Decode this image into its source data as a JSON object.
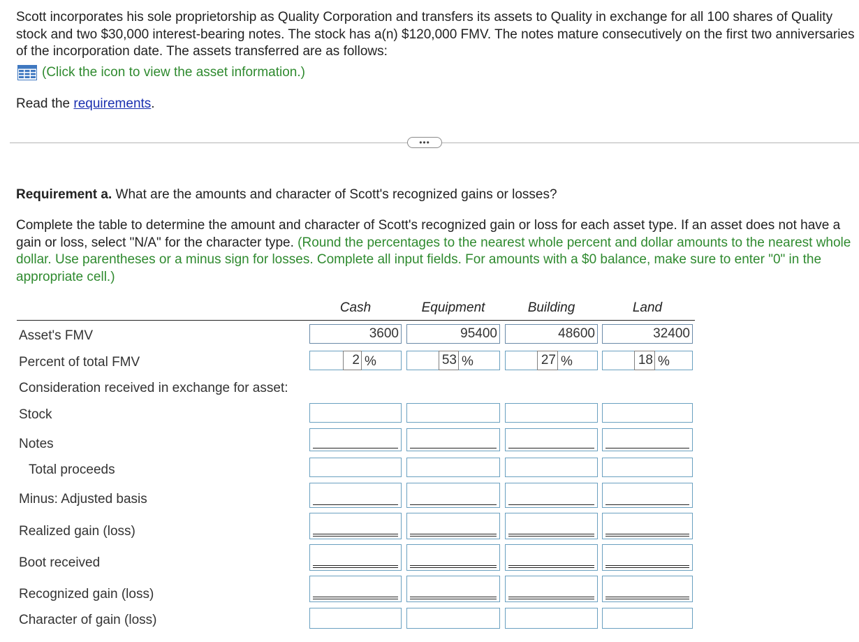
{
  "intro": {
    "text": "Scott incorporates his sole proprietorship as Quality Corporation and transfers its assets to Quality in exchange for all 100 shares of Quality stock and two $30,000 interest-bearing notes. The stock has a(n) $120,000 FMV. The notes mature consecutively on the first two anniversaries of the incorporation date. The assets transferred are as follows:",
    "asset_link": "(Click the icon to view the asset information.)",
    "read_prefix": "Read the ",
    "read_link": "requirements",
    "read_suffix": "."
  },
  "more_button": "•••",
  "requirement": {
    "label": "Requirement a.",
    "question": " What are the amounts and character of Scott's recognized gains or losses?",
    "instructions": "Complete the table to determine the amount and character of Scott's recognized gain or loss for each asset type. If an asset does not have a gain or loss, select \"N/A\" for the character type. ",
    "instructions_green": "(Round the percentages to the nearest whole percent and dollar amounts to the nearest whole dollar. Use parentheses or a minus sign for losses. Complete all input fields. For amounts with a $0 balance, make sure to enter \"0\" in the appropriate cell.)"
  },
  "table": {
    "columns": [
      "Cash",
      "Equipment",
      "Building",
      "Land"
    ],
    "rows": [
      {
        "label": "Asset's FMV",
        "values": [
          "3600",
          "95400",
          "48600",
          "32400"
        ]
      },
      {
        "label": "Percent of total FMV",
        "values": [
          "2",
          "53",
          "27",
          "18"
        ],
        "suffix": "%"
      },
      {
        "label": "Consideration received in exchange for asset:"
      },
      {
        "label": "Stock",
        "values": [
          "",
          "",
          "",
          ""
        ]
      },
      {
        "label": "Notes",
        "values": [
          "",
          "",
          "",
          ""
        ]
      },
      {
        "label": "Total proceeds",
        "values": [
          "",
          "",
          "",
          ""
        ]
      },
      {
        "label": "Minus: Adjusted basis",
        "values": [
          "",
          "",
          "",
          ""
        ]
      },
      {
        "label": "Realized gain (loss)",
        "values": [
          "",
          "",
          "",
          ""
        ]
      },
      {
        "label": "Boot received",
        "values": [
          "",
          "",
          "",
          ""
        ]
      },
      {
        "label": "Recognized gain (loss)",
        "values": [
          "",
          "",
          "",
          ""
        ]
      },
      {
        "label": "Character of gain (loss)",
        "values": [
          "",
          "",
          "",
          ""
        ]
      }
    ]
  }
}
